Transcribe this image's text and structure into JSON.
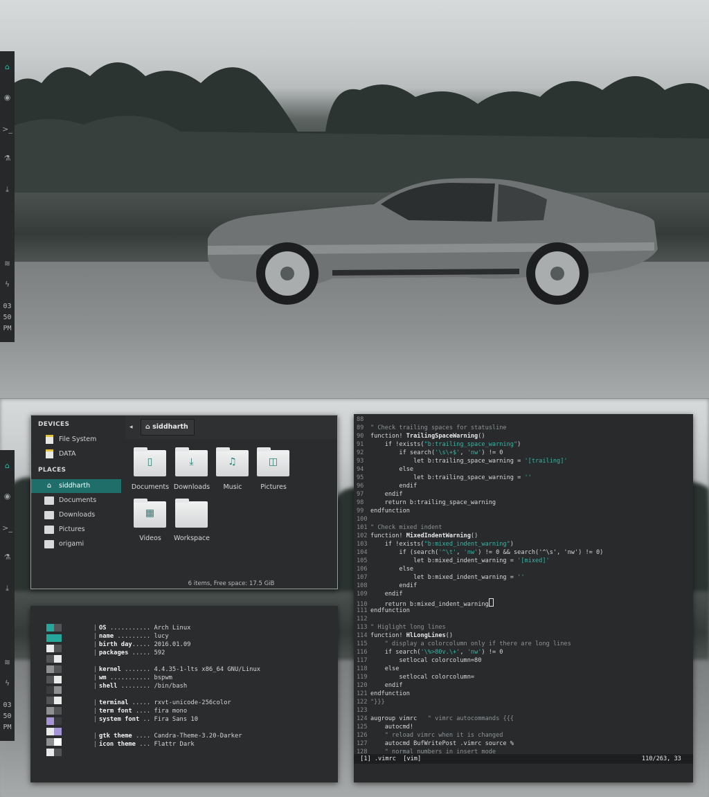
{
  "sidebar": {
    "clock": [
      "03",
      "50",
      "PM"
    ]
  },
  "file_manager": {
    "devices_label": "DEVICES",
    "devices": [
      {
        "label": "File System"
      },
      {
        "label": "DATA"
      }
    ],
    "places_label": "PLACES",
    "places": [
      {
        "label": "siddharth",
        "selected": true
      },
      {
        "label": "Documents"
      },
      {
        "label": "Downloads"
      },
      {
        "label": "Pictures"
      },
      {
        "label": "origami"
      }
    ],
    "breadcrumb": "siddharth",
    "items": [
      {
        "label": "Documents",
        "icon": "document-icon"
      },
      {
        "label": "Downloads",
        "icon": "download-icon"
      },
      {
        "label": "Music",
        "icon": "music-icon"
      },
      {
        "label": "Pictures",
        "icon": "camera-icon"
      },
      {
        "label": "Videos",
        "icon": "film-icon"
      },
      {
        "label": "Workspace",
        "icon": "folder-icon"
      }
    ],
    "status": "6 items, Free space: 17.5 GiB"
  },
  "sysinfo": {
    "lines": [
      {
        "key": "OS",
        "dots": " ...........",
        "val": " Arch Linux"
      },
      {
        "key": "name",
        "dots": " .........",
        "val": " lucy"
      },
      {
        "key": "birth day",
        "dots": ".....",
        "val": " 2016.01.09"
      },
      {
        "key": "packages",
        "dots": " .....",
        "val": " 592"
      },
      {
        "key": "kernel",
        "dots": " .......",
        "val": " 4.4.35-1-lts x86_64 GNU/Linux"
      },
      {
        "key": "wm",
        "dots": " ...........",
        "val": " bspwm"
      },
      {
        "key": "shell",
        "dots": " ........",
        "val": " /bin/bash"
      },
      {
        "key": "terminal",
        "dots": " .....",
        "val": " rxvt-unicode-256color"
      },
      {
        "key": "term font",
        "dots": " ....",
        "val": " fira mono"
      },
      {
        "key": "system font",
        "dots": " ..",
        "val": " Fira Sans 10"
      },
      {
        "key": "gtk theme",
        "dots": " ....",
        "val": " Candra-Theme-3.20-Darker"
      },
      {
        "key": "icon theme",
        "dots": " ...",
        "val": " Flattr Dark"
      }
    ],
    "colors": [
      "#525455",
      "#25a79c",
      "#e9eaea",
      "#8e9092",
      "#a694d6",
      "#ffffff",
      "#3a3c3d"
    ]
  },
  "vim": {
    "lines": [
      {
        "n": "88",
        "t": ""
      },
      {
        "n": "89",
        "t": "\" Check trailing spaces for statusline",
        "cls": "c"
      },
      {
        "n": "90",
        "t": "function! TrailingSpaceWarning()",
        "kw": true
      },
      {
        "n": "91",
        "pre": "    if !exists(",
        "str": "\"b:trailing_space_warning\"",
        "post": ")"
      },
      {
        "n": "92",
        "pre": "        if search(",
        "str": "'\\s\\+$'",
        "mid": ", ",
        "str2": "'nw'",
        "post": ") != 0"
      },
      {
        "n": "93",
        "pre": "            let b:trailing_space_warning = ",
        "str": "'[trailing]'",
        "post": ""
      },
      {
        "n": "94",
        "t": "        else"
      },
      {
        "n": "95",
        "pre": "            let b:trailing_space_warning = ",
        "str": "''",
        "post": ""
      },
      {
        "n": "96",
        "t": "        endif"
      },
      {
        "n": "97",
        "t": "    endif"
      },
      {
        "n": "98",
        "t": "    return b:trailing_space_warning"
      },
      {
        "n": "99",
        "t": "endfunction"
      },
      {
        "n": "100",
        "t": ""
      },
      {
        "n": "101",
        "t": "\" Check mixed indent",
        "cls": "c"
      },
      {
        "n": "102",
        "t": "function! MixedIndentWarning()",
        "kw": true
      },
      {
        "n": "103",
        "pre": "    if !exists(",
        "str": "\"b:mixed_indent_warning\"",
        "post": ")"
      },
      {
        "n": "104",
        "pre": "        if (search(",
        "str": "'^\\t'",
        "mid": ", ",
        "str2": "'nw'",
        "post": ") != 0 && search('^\\s', 'nw') != 0)"
      },
      {
        "n": "105",
        "pre": "            let b:mixed_indent_warning = ",
        "str": "'[mixed]'",
        "post": ""
      },
      {
        "n": "106",
        "t": "        else"
      },
      {
        "n": "107",
        "pre": "            let b:mixed_indent_warning = ",
        "str": "''",
        "post": ""
      },
      {
        "n": "108",
        "t": "        endif"
      },
      {
        "n": "109",
        "t": "    endif"
      },
      {
        "n": "110",
        "t": "    return b:mixed_indent_warning",
        "cursor": true
      },
      {
        "n": "111",
        "t": "endfunction"
      },
      {
        "n": "112",
        "t": ""
      },
      {
        "n": "113",
        "t": "\" Higlight long lines",
        "cls": "c"
      },
      {
        "n": "114",
        "t": "function! HlLongLines()",
        "kw": true
      },
      {
        "n": "115",
        "t": "    \" display a colorcolumn only if there are long lines",
        "cls": "c"
      },
      {
        "n": "116",
        "pre": "    if search(",
        "str": "'\\%>80v.\\+'",
        "mid": ", ",
        "str2": "'nw'",
        "post": ") != 0"
      },
      {
        "n": "117",
        "t": "        setlocal colorcolumn=80"
      },
      {
        "n": "118",
        "t": "    else"
      },
      {
        "n": "119",
        "t": "        setlocal colorcolumn="
      },
      {
        "n": "120",
        "t": "    endif"
      },
      {
        "n": "121",
        "t": "endfunction"
      },
      {
        "n": "122",
        "t": "\"}}}",
        "cls": "c"
      },
      {
        "n": "123",
        "t": ""
      },
      {
        "n": "124",
        "pre": "augroup vimrc   ",
        "str": "",
        "post": "\" vimrc autocommands {{{",
        "augroup": true
      },
      {
        "n": "125",
        "t": "    autocmd!"
      },
      {
        "n": "126",
        "t": "    \" reload vimrc when it is changed",
        "cls": "c"
      },
      {
        "n": "127",
        "t": "    autocmd BufWritePost .vimrc source %"
      },
      {
        "n": "128",
        "t": "    \" normal numbers in insert mode",
        "cls": "c"
      }
    ],
    "status_left": " [1] .vimrc  [vim]",
    "status_right": "110/263, 33 "
  }
}
